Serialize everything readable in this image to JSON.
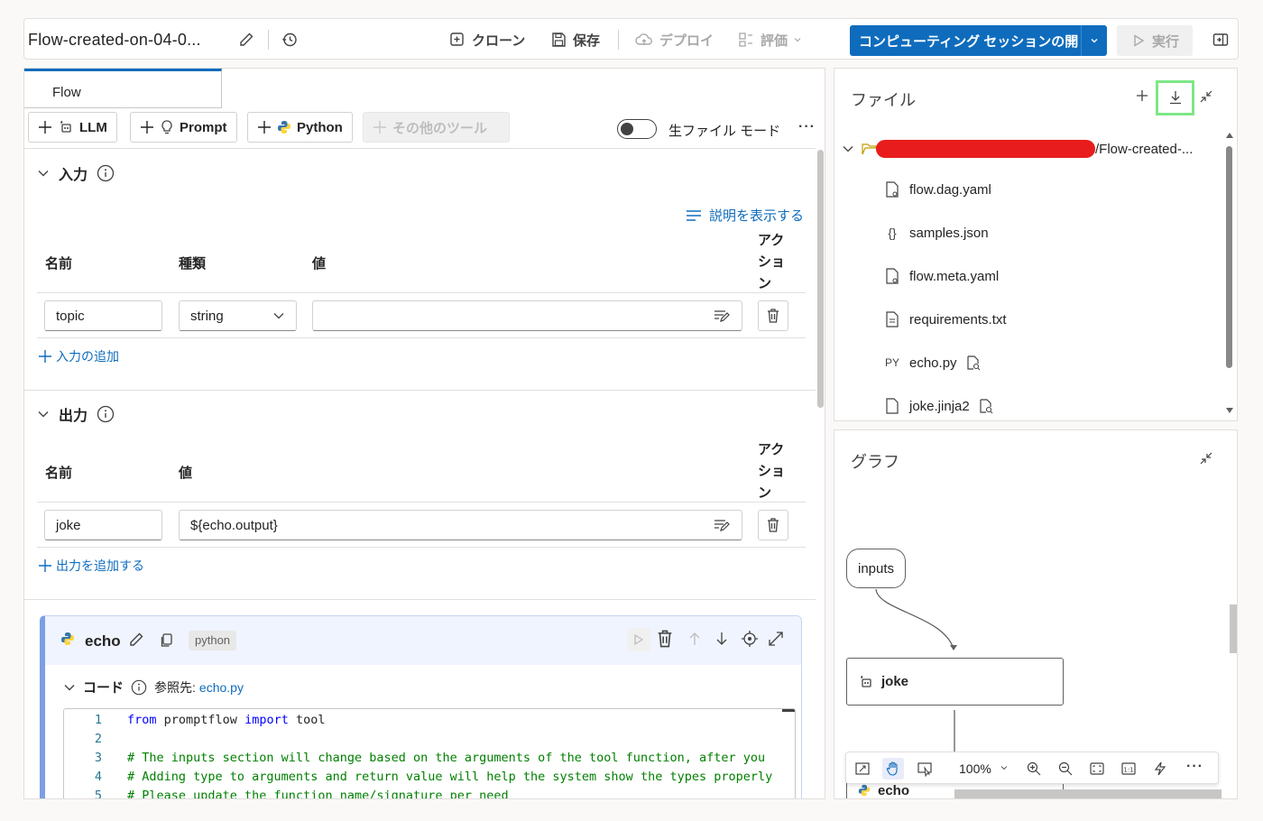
{
  "toolbar": {
    "flow_title": "Flow-created-on-04-0...",
    "clone_label": "クローン",
    "save_label": "保存",
    "deploy_label": "デプロイ",
    "evaluate_label": "評価",
    "compute_session_label": "コンピューティング セッションの開",
    "run_label": "実行"
  },
  "left": {
    "tab_label": "Flow",
    "tools": {
      "llm": "LLM",
      "prompt": "Prompt",
      "python": "Python",
      "more": "その他のツール"
    },
    "raw_file_mode": "生ファイル モード",
    "inputs": {
      "title": "入力",
      "show_desc": "説明を表示する",
      "col_name": "名前",
      "col_type": "種類",
      "col_value": "値",
      "col_action_lines": [
        "アク",
        "ショ",
        "ン"
      ],
      "row": {
        "name": "topic",
        "type": "string",
        "value": ""
      },
      "add_label": "入力の追加"
    },
    "outputs": {
      "title": "出力",
      "col_name": "名前",
      "col_value": "値",
      "col_action_lines": [
        "アク",
        "ショ",
        "ン"
      ],
      "row": {
        "name": "joke",
        "value": "${echo.output}"
      },
      "add_label": "出力を追加する"
    },
    "echo_node": {
      "name": "echo",
      "badge": "python",
      "code_label": "コード",
      "ref_label": "参照先:",
      "ref_file": "echo.py",
      "code_lines": [
        {
          "n": "1",
          "text": "from promptflow import tool"
        },
        {
          "n": "2",
          "text": ""
        },
        {
          "n": "3",
          "text": "# The inputs section will change based on the arguments of the tool function, after you"
        },
        {
          "n": "4",
          "text": "# Adding type to arguments and return value will help the system show the types properly"
        },
        {
          "n": "5",
          "text": "# Please update the function name/signature per need"
        }
      ]
    }
  },
  "files": {
    "title": "ファイル",
    "root_suffix": "/Flow-created-...",
    "items": [
      {
        "name": "flow.dag.yaml",
        "icon": "file-settings-icon"
      },
      {
        "name": "samples.json",
        "icon": "braces-icon"
      },
      {
        "name": "flow.meta.yaml",
        "icon": "file-settings-icon"
      },
      {
        "name": "requirements.txt",
        "icon": "file-text-icon"
      },
      {
        "name": "echo.py",
        "icon": "python-file-icon",
        "prefix": "PY"
      },
      {
        "name": "joke.jinja2",
        "icon": "file-icon"
      }
    ],
    "highlight_color": "#7ee787",
    "redact_color": "#e81c1c"
  },
  "graph": {
    "title": "グラフ",
    "nodes": {
      "inputs": "inputs",
      "joke": "joke",
      "echo": "echo"
    },
    "zoom": "100%"
  },
  "colors": {
    "accent": "#0f6cbd",
    "link": "#0f6cbd"
  }
}
